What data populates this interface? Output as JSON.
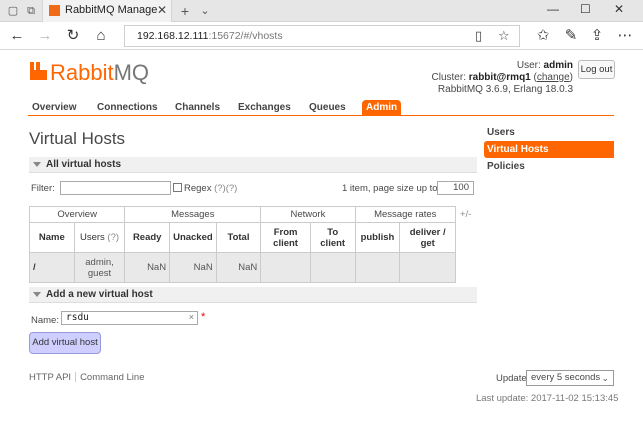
{
  "browser": {
    "tab_title": "RabbitMQ Managemen",
    "url_host": "192.168.12.111",
    "url_rest": ":15672/#/vhosts"
  },
  "logo": {
    "rabbit": "Rabbit",
    "mq": "MQ"
  },
  "login": {
    "user_label": "User:",
    "user": "admin",
    "cluster_label": "Cluster:",
    "cluster": "rabbit@rmq1",
    "change_link": "change",
    "version": "RabbitMQ 3.6.9, Erlang 18.0.3",
    "logout": "Log out"
  },
  "tabs": [
    "Overview",
    "Connections",
    "Channels",
    "Exchanges",
    "Queues",
    "Admin"
  ],
  "page_title": "Virtual Hosts",
  "all_vhosts": {
    "header": "All virtual hosts",
    "filter_label": "Filter:",
    "regex_label": "Regex",
    "regex_help": "(?)(?)",
    "paging_label": "1 item, page size up to",
    "page_size": "100",
    "plus_minus": "+/-",
    "groups": {
      "overview": "Overview",
      "messages": "Messages",
      "network": "Network",
      "rates": "Message rates"
    },
    "columns": {
      "name": "Name",
      "users": "Users",
      "users_help": "(?)",
      "ready": "Ready",
      "unacked": "Unacked",
      "total": "Total",
      "from_client": "From client",
      "to_client": "To client",
      "publish": "publish",
      "deliver_get": "deliver / get"
    },
    "rows": [
      {
        "name": "/",
        "users": "admin, guest",
        "ready": "NaN",
        "unacked": "NaN",
        "total": "NaN"
      }
    ]
  },
  "add_vhost": {
    "header": "Add a new virtual host",
    "name_label": "Name:",
    "name_value": "rsdu",
    "clear": "×",
    "required": "*",
    "button": "Add virtual host"
  },
  "footer": {
    "http_api": "HTTP API",
    "command_line": "Command Line"
  },
  "update": {
    "label": "Update",
    "selected": "every 5 seconds",
    "last_update": "Last update: 2017-11-02 15:13:45"
  },
  "sidebar": [
    "Users",
    "Virtual Hosts",
    "Policies"
  ],
  "colors": {
    "accent": "#ff6600",
    "button": "#cfcfff"
  }
}
